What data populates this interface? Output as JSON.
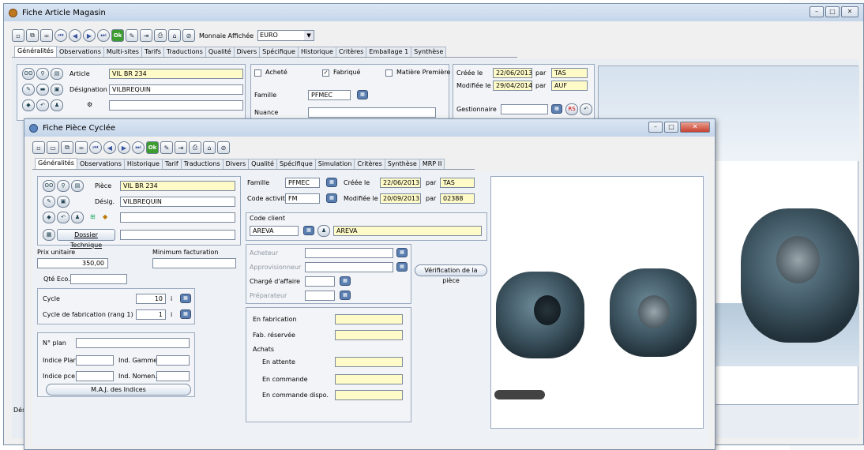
{
  "back_window": {
    "title": "Fiche Article Magasin",
    "currency_label": "Monnaie Affichée",
    "currency_value": "EURO",
    "tabs": [
      "Généralités",
      "Observations",
      "Multi-sites",
      "Tarifs",
      "Traductions",
      "Qualité",
      "Divers",
      "Spécifique",
      "Historique",
      "Critères",
      "Emballage 1",
      "Synthèse"
    ],
    "article_label": "Article",
    "article_value": "VIL BR 234",
    "designation_label": "Désignation",
    "designation_value": "VILBREQUIN",
    "achete_label": "Acheté",
    "fabrique_label": "Fabriqué",
    "matiere_label": "Matière Première",
    "famille_label": "Famille",
    "famille_value": "PFMEC",
    "nuance_label": "Nuance",
    "creee_label": "Créée le",
    "creee_date": "22/06/2013",
    "creee_par": "par",
    "creee_user": "TAS",
    "modifiee_label": "Modifiée le",
    "modifiee_date": "29/04/2014",
    "modifiee_par": "par",
    "modifiee_user": "AUF",
    "gestionnaire_label": "Gestionnaire",
    "bottom_left": "Dés"
  },
  "front_window": {
    "title": "Fiche Pièce Cyclée",
    "tabs": [
      "Généralités",
      "Observations",
      "Historique",
      "Tarif",
      "Traductions",
      "Divers",
      "Qualité",
      "Spécifique",
      "Simulation",
      "Critères",
      "Synthèse",
      "MRP II"
    ],
    "piece_label": "Pièce",
    "piece_value": "VIL BR 234",
    "desig_label": "Désig.",
    "desig_value": "VILBREQUIN",
    "dossier_button": "Dossier Technique",
    "famille_label": "Famille",
    "famille_value": "PFMEC",
    "code_activite_label": "Code activité",
    "code_activite_value": "FM",
    "creee_label": "Créée le",
    "creee_date": "22/06/2013",
    "creee_par": "par",
    "creee_user": "TAS",
    "modifiee_label": "Modifiée le",
    "modifiee_date": "20/09/2013",
    "modifiee_par": "par",
    "modifiee_user": "02388",
    "code_client_label": "Code client",
    "code_client_value": "AREVA",
    "client_name": "AREVA",
    "prix_label": "Prix unitaire",
    "prix_value": "350,00",
    "min_fact_label": "Minimum facturation",
    "qte_eco_label": "Qté Eco.",
    "cycle_label": "Cycle",
    "cycle_value": "10",
    "cycle_unit": "i",
    "cycle_fab_label": "Cycle de fabrication (rang 1)",
    "cycle_fab_value": "1",
    "cycle_fab_unit": "i",
    "acheteur_label": "Acheteur",
    "approvisionneur_label": "Approvisionneur",
    "charge_label": "Chargé d'affaire",
    "preparateur_label": "Préparateur",
    "verification_button": "Vérification de la pièce",
    "n_plan_label": "N° plan",
    "indice_plan_label": "Indice Plan",
    "ind_gamme_label": "Ind. Gamme",
    "indice_pce_label": "Indice pce",
    "ind_nomen_label": "Ind. Nomen.",
    "maj_button": "M.A.J. des Indices",
    "en_fabrication_label": "En fabrication",
    "fab_reservee_label": "Fab. réservée",
    "achats_label": "Achats",
    "en_attente_label": "En attente",
    "en_commande_label": "En commande",
    "en_commande_dispo_label": "En commande dispo."
  },
  "colors": {
    "accent": "#fffbc8",
    "titlebar": "#c4d5ea"
  }
}
